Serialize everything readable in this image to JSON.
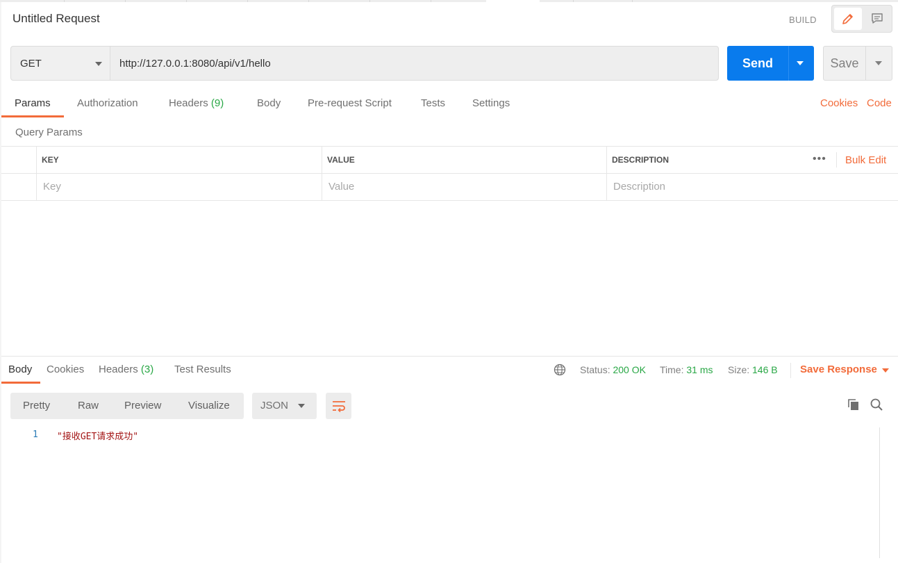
{
  "header": {
    "title": "Untitled Request",
    "build_label": "BUILD"
  },
  "request": {
    "method": "GET",
    "url": "http://127.0.0.1:8080/api/v1/hello",
    "send_label": "Send",
    "save_label": "Save"
  },
  "request_tabs": [
    {
      "label": "Params",
      "active": true
    },
    {
      "label": "Authorization"
    },
    {
      "label": "Headers",
      "count": "(9)"
    },
    {
      "label": "Body"
    },
    {
      "label": "Pre-request Script"
    },
    {
      "label": "Tests"
    },
    {
      "label": "Settings"
    }
  ],
  "links": {
    "cookies": "Cookies",
    "code": "Code",
    "bulk_edit": "Bulk Edit"
  },
  "params": {
    "section_label": "Query Params",
    "columns": [
      "KEY",
      "VALUE",
      "DESCRIPTION"
    ],
    "placeholders": {
      "key": "Key",
      "value": "Value",
      "description": "Description"
    }
  },
  "response_tabs": [
    {
      "label": "Body",
      "active": true
    },
    {
      "label": "Cookies"
    },
    {
      "label": "Headers",
      "count": "(3)"
    },
    {
      "label": "Test Results"
    }
  ],
  "response_status": {
    "status_label": "Status:",
    "status_value": "200 OK",
    "time_label": "Time:",
    "time_value": "31 ms",
    "size_label": "Size:",
    "size_value": "146 B",
    "save_response": "Save Response"
  },
  "view_modes": [
    "Pretty",
    "Raw",
    "Preview",
    "Visualize"
  ],
  "format": "JSON",
  "response_body": [
    {
      "line": "1",
      "text": "\"接收GET请求成功\""
    }
  ],
  "colors": {
    "accent": "#f26b3a",
    "send": "#097bed",
    "success": "#28a745"
  },
  "icons": [
    "edit-icon",
    "comment-icon",
    "globe-icon",
    "wrap-icon",
    "copy-icon",
    "search-icon"
  ]
}
